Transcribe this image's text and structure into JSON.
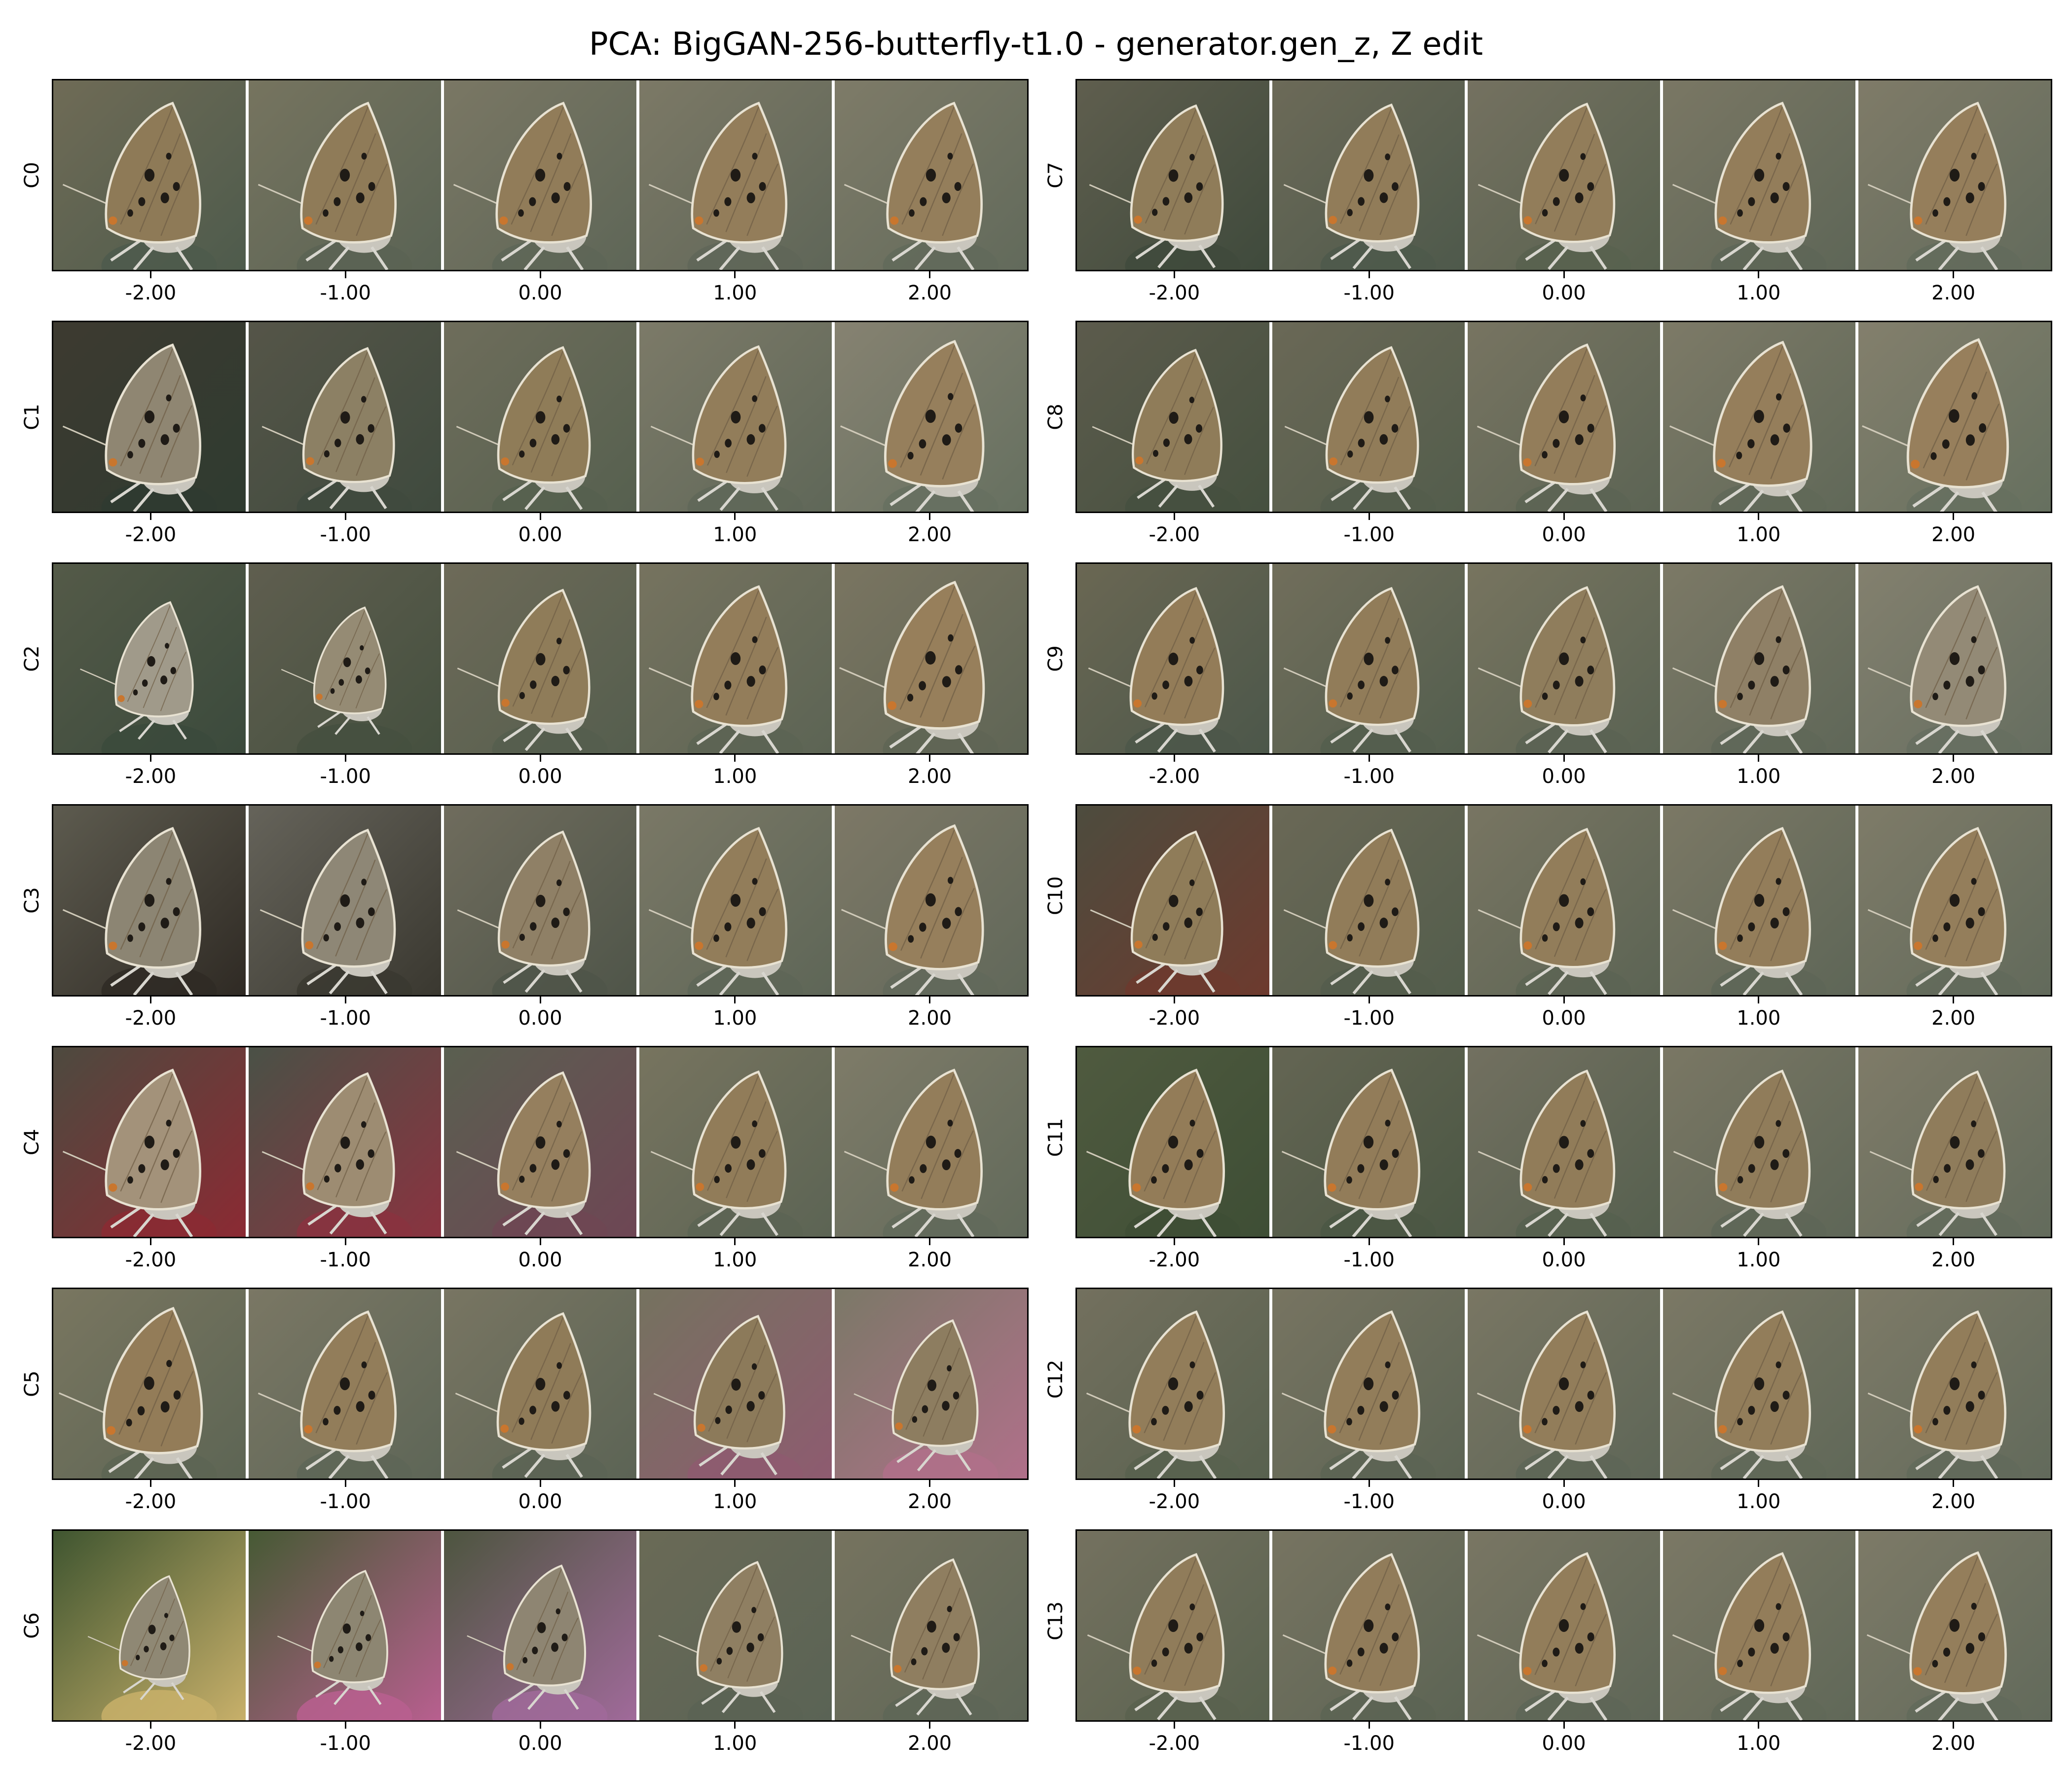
{
  "title": "PCA: BigGAN-256-butterfly-t1.0 - generator.gen_z, Z edit",
  "columns": [
    "-2.00",
    "-1.00",
    "0.00",
    "1.00",
    "2.00"
  ],
  "panels": [
    {
      "label": "C0",
      "variants": [
        {
          "bg": "#6f6b56",
          "wing": "#8e7a57",
          "scale": 1.0,
          "accent": "#4e5b4c"
        },
        {
          "bg": "#76745f",
          "wing": "#8f7b58",
          "scale": 1.0,
          "accent": "#5a6354"
        },
        {
          "bg": "#7a7764",
          "wing": "#917c59",
          "scale": 1.0,
          "accent": "#5e6657"
        },
        {
          "bg": "#7c7966",
          "wing": "#937d5a",
          "scale": 1.0,
          "accent": "#5f6658"
        },
        {
          "bg": "#7e7b68",
          "wing": "#947e5b",
          "scale": 1.0,
          "accent": "#626a5b"
        }
      ]
    },
    {
      "label": "C1",
      "variants": [
        {
          "bg": "#3d3a30",
          "wing": "#8f8672",
          "scale": 1.0,
          "accent": "#2f3b30"
        },
        {
          "bg": "#555548",
          "wing": "#8c8064",
          "scale": 0.96,
          "accent": "#3f4a3e"
        },
        {
          "bg": "#6e6d5b",
          "wing": "#8f7c58",
          "scale": 0.97,
          "accent": "#56604f"
        },
        {
          "bg": "#7c7a68",
          "wing": "#927d5a",
          "scale": 0.98,
          "accent": "#5f6758"
        },
        {
          "bg": "#868271",
          "wing": "#967f5c",
          "scale": 1.04,
          "accent": "#667060"
        }
      ]
    },
    {
      "label": "C2",
      "variants": [
        {
          "bg": "#545a48",
          "wing": "#a09a8a",
          "scale": 0.82,
          "accent": "#3b4a3c"
        },
        {
          "bg": "#5f5e4f",
          "wing": "#958b74",
          "scale": 0.76,
          "accent": "#45503f"
        },
        {
          "bg": "#6d6a58",
          "wing": "#8f7c59",
          "scale": 0.96,
          "accent": "#555e4e"
        },
        {
          "bg": "#76735f",
          "wing": "#937d5a",
          "scale": 1.0,
          "accent": "#5c6454"
        },
        {
          "bg": "#7a7561",
          "wing": "#977f5b",
          "scale": 1.05,
          "accent": "#5f6555"
        }
      ]
    },
    {
      "label": "C3",
      "variants": [
        {
          "bg": "#5d5b4f",
          "wing": "#8c8573",
          "scale": 1.0,
          "accent": "#2f2a24"
        },
        {
          "bg": "#65635a",
          "wing": "#8e8776",
          "scale": 0.98,
          "accent": "#3a3830"
        },
        {
          "bg": "#6f6c5d",
          "wing": "#8f8066",
          "scale": 0.96,
          "accent": "#4f5549"
        },
        {
          "bg": "#7a7866",
          "wing": "#927d5a",
          "scale": 1.0,
          "accent": "#5e6657"
        },
        {
          "bg": "#7d7866",
          "wing": "#967f5c",
          "scale": 1.03,
          "accent": "#61685a"
        }
      ]
    },
    {
      "label": "C4",
      "variants": [
        {
          "bg": "#4d4a3f",
          "wing": "#a3927a",
          "scale": 1.0,
          "accent": "#8b2a33"
        },
        {
          "bg": "#4a5146",
          "wing": "#9d8c72",
          "scale": 0.96,
          "accent": "#8a3340"
        },
        {
          "bg": "#5a5f50",
          "wing": "#957f5e",
          "scale": 0.97,
          "accent": "#6e4654"
        },
        {
          "bg": "#77745f",
          "wing": "#917c59",
          "scale": 0.98,
          "accent": "#5c6454"
        },
        {
          "bg": "#7e7b68",
          "wing": "#937d5a",
          "scale": 1.0,
          "accent": "#626a5b"
        }
      ]
    },
    {
      "label": "C5",
      "variants": [
        {
          "bg": "#797660",
          "wing": "#937c58",
          "scale": 1.04,
          "accent": "#5d6554"
        },
        {
          "bg": "#7a7764",
          "wing": "#927d5a",
          "scale": 1.0,
          "accent": "#5e6657"
        },
        {
          "bg": "#787562",
          "wing": "#8f7b58",
          "scale": 0.98,
          "accent": "#5c6455"
        },
        {
          "bg": "#75725f",
          "wing": "#8c7a5a",
          "scale": 0.95,
          "accent": "#8e5b70"
        },
        {
          "bg": "#7b7867",
          "wing": "#8d7d60",
          "scale": 0.9,
          "accent": "#b0708a"
        }
      ]
    },
    {
      "label": "C6",
      "variants": [
        {
          "bg": "#3f5530",
          "wing": "#8f8874",
          "scale": 0.74,
          "accent": "#c8b06a"
        },
        {
          "bg": "#465a34",
          "wing": "#8d8672",
          "scale": 0.8,
          "accent": "#b85f8f"
        },
        {
          "bg": "#4d553f",
          "wing": "#8e8572",
          "scale": 0.86,
          "accent": "#a06a9a"
        },
        {
          "bg": "#6a6a56",
          "wing": "#8f7f62",
          "scale": 0.9,
          "accent": "#5a6355"
        },
        {
          "bg": "#76735f",
          "wing": "#8f7e60",
          "scale": 0.93,
          "accent": "#5e6657"
        }
      ]
    },
    {
      "label": "C7",
      "variants": [
        {
          "bg": "#5f5e4e",
          "wing": "#8f7c59",
          "scale": 0.97,
          "accent": "#3f4a3c"
        },
        {
          "bg": "#6c6a58",
          "wing": "#917c59",
          "scale": 0.98,
          "accent": "#4e594b"
        },
        {
          "bg": "#747160",
          "wing": "#927d5a",
          "scale": 0.99,
          "accent": "#58614f"
        },
        {
          "bg": "#7a7764",
          "wing": "#937d5a",
          "scale": 1.0,
          "accent": "#5e6657"
        },
        {
          "bg": "#7f7b68",
          "wing": "#957e5b",
          "scale": 1.0,
          "accent": "#636b5c"
        }
      ]
    },
    {
      "label": "C8",
      "variants": [
        {
          "bg": "#5c5b4c",
          "wing": "#8f7c59",
          "scale": 0.94,
          "accent": "#45503f"
        },
        {
          "bg": "#6a6856",
          "wing": "#917c59",
          "scale": 0.97,
          "accent": "#535d4c"
        },
        {
          "bg": "#777461",
          "wing": "#937d5a",
          "scale": 1.0,
          "accent": "#5c6454"
        },
        {
          "bg": "#7d7a67",
          "wing": "#957e5b",
          "scale": 1.03,
          "accent": "#606858"
        },
        {
          "bg": "#837f6c",
          "wing": "#977f5c",
          "scale": 1.06,
          "accent": "#66705f"
        }
      ]
    },
    {
      "label": "C9",
      "variants": [
        {
          "bg": "#6a6753",
          "wing": "#937c58",
          "scale": 0.98,
          "accent": "#4c574a"
        },
        {
          "bg": "#716e5b",
          "wing": "#917c59",
          "scale": 0.98,
          "accent": "#535e4e"
        },
        {
          "bg": "#77745f",
          "wing": "#8f7d5c",
          "scale": 0.99,
          "accent": "#5a6353"
        },
        {
          "bg": "#7c7966",
          "wing": "#8f8066",
          "scale": 1.0,
          "accent": "#5f6758"
        },
        {
          "bg": "#83806e",
          "wing": "#938a76",
          "scale": 1.0,
          "accent": "#666e60"
        }
      ]
    },
    {
      "label": "C10",
      "variants": [
        {
          "bg": "#4d4c3e",
          "wing": "#8f7c59",
          "scale": 0.96,
          "accent": "#6d3a2e"
        },
        {
          "bg": "#6a6856",
          "wing": "#917c59",
          "scale": 0.98,
          "accent": "#535d4c"
        },
        {
          "bg": "#787562",
          "wing": "#927d5a",
          "scale": 0.99,
          "accent": "#5c6454"
        },
        {
          "bg": "#7b7865",
          "wing": "#937d5a",
          "scale": 1.0,
          "accent": "#5e6657"
        },
        {
          "bg": "#7e7b68",
          "wing": "#947e5b",
          "scale": 1.0,
          "accent": "#626a5b"
        }
      ]
    },
    {
      "label": "C11",
      "variants": [
        {
          "bg": "#4f5a3f",
          "wing": "#937c58",
          "scale": 1.0,
          "accent": "#3e4e35"
        },
        {
          "bg": "#646553",
          "wing": "#927c59",
          "scale": 1.0,
          "accent": "#4b5744"
        },
        {
          "bg": "#727060",
          "wing": "#917c59",
          "scale": 0.99,
          "accent": "#56604f"
        },
        {
          "bg": "#7a7764",
          "wing": "#907c5a",
          "scale": 0.99,
          "accent": "#5e6657"
        },
        {
          "bg": "#7f7b68",
          "wing": "#8f7c5b",
          "scale": 0.98,
          "accent": "#636b5c"
        }
      ]
    },
    {
      "label": "C12",
      "variants": [
        {
          "bg": "#73705e",
          "wing": "#927d5a",
          "scale": 1.0,
          "accent": "#58614f"
        },
        {
          "bg": "#777461",
          "wing": "#927d5a",
          "scale": 1.0,
          "accent": "#5c6454"
        },
        {
          "bg": "#797663",
          "wing": "#927d5a",
          "scale": 1.0,
          "accent": "#5e6657"
        },
        {
          "bg": "#7b7865",
          "wing": "#927d5a",
          "scale": 1.0,
          "accent": "#606858"
        },
        {
          "bg": "#7d7a67",
          "wing": "#927d5a",
          "scale": 1.0,
          "accent": "#626a5b"
        }
      ]
    },
    {
      "label": "C13",
      "variants": [
        {
          "bg": "#74715f",
          "wing": "#907c5a",
          "scale": 0.99,
          "accent": "#59624f"
        },
        {
          "bg": "#777461",
          "wing": "#917c5a",
          "scale": 0.99,
          "accent": "#5c6454"
        },
        {
          "bg": "#797663",
          "wing": "#927d5a",
          "scale": 1.0,
          "accent": "#5e6657"
        },
        {
          "bg": "#7b7865",
          "wing": "#937d5a",
          "scale": 1.0,
          "accent": "#606858"
        },
        {
          "bg": "#7d7a67",
          "wing": "#947e5b",
          "scale": 1.01,
          "accent": "#626a5b"
        }
      ]
    }
  ]
}
